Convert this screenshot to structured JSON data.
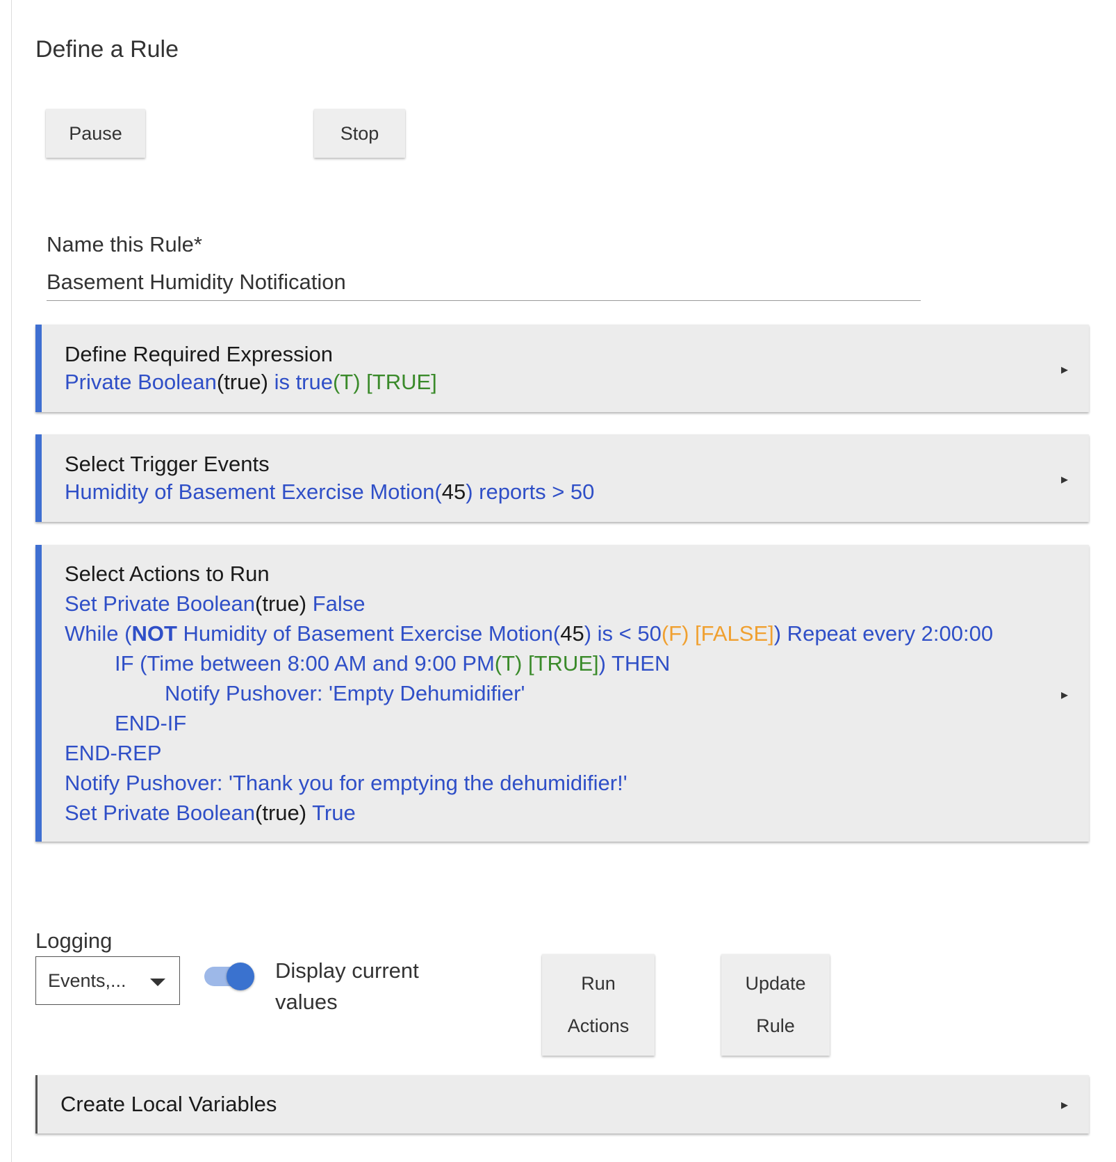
{
  "page": {
    "title": "Define a Rule"
  },
  "controls": {
    "pause_label": "Pause",
    "stop_label": "Stop"
  },
  "name_field": {
    "label": "Name this Rule*",
    "value": "Basement Humidity Notification"
  },
  "required_expression": {
    "heading": "Define Required Expression",
    "parts": {
      "p1": "Private Boolean",
      "p2": "(true)",
      "p3": " is true",
      "p4": "(T) [TRUE]"
    }
  },
  "triggers": {
    "heading": "Select Trigger Events",
    "parts": {
      "p1": "Humidity of Basement Exercise Motion(",
      "p2": "45",
      "p3": ") reports > 50"
    }
  },
  "actions": {
    "heading": "Select Actions to Run",
    "line1": {
      "a": "Set Private Boolean",
      "b": "(true)",
      "c": " False"
    },
    "line2": {
      "a": "While (",
      "b": "NOT",
      "c": " Humidity of Basement Exercise Motion(",
      "d": "45",
      "e": ") is < 50",
      "f": "(F) [FALSE]",
      "g": ") Repeat every 2:00:00"
    },
    "line3": {
      "a": "IF (Time between 8:00 AM and 9:00 PM",
      "b": "(T) [TRUE]",
      "c": ") THEN"
    },
    "line4": "Notify Pushover: 'Empty Dehumidifier'",
    "line5": "END-IF",
    "line6": "END-REP",
    "line7": "Notify Pushover: 'Thank you for emptying the dehumidifier!'",
    "line8": {
      "a": "Set Private Boolean",
      "b": "(true)",
      "c": " True"
    }
  },
  "logging": {
    "label": "Logging",
    "selected": "Events,..."
  },
  "display_toggle": {
    "label": "Display current values",
    "on": true
  },
  "run_button": {
    "line1": "Run",
    "line2": "Actions"
  },
  "update_button": {
    "line1": "Update",
    "line2": "Rule"
  },
  "local_variables": {
    "heading": "Create Local Variables"
  },
  "icons": {
    "expand": "▸"
  },
  "colors": {
    "accent": "#3f6fd1",
    "link": "#2f4fc7",
    "true": "#3a8a2a",
    "false": "#f0a030",
    "toggle": "#3a72cf"
  }
}
